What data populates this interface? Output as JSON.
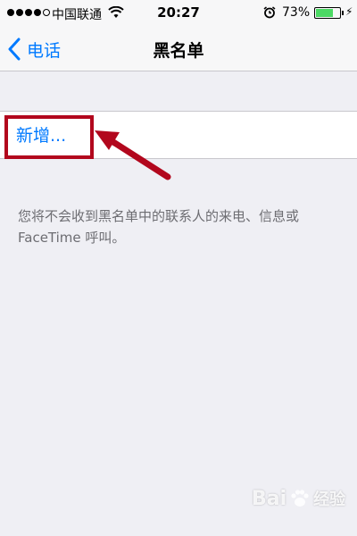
{
  "status_bar": {
    "carrier": "中国联通",
    "time": "20:27",
    "battery_percent": "73%",
    "battery_level": 0.73,
    "signal_bars_filled": 4,
    "icons": [
      "signal-dots-icon",
      "wifi-icon",
      "alarm-icon",
      "battery-icon",
      "charging-icon"
    ]
  },
  "nav": {
    "back_label": "电话",
    "title": "黑名单"
  },
  "list": {
    "add_label": "新增..."
  },
  "footer": {
    "note": "您将不会收到黑名单中的联系人的来电、信息或 FaceTime 呼叫。"
  },
  "annotation": {
    "highlight_color": "#b2071d"
  },
  "watermark": {
    "text_left": "Bai",
    "text_right": "经验"
  },
  "colors": {
    "accent": "#007aff",
    "background": "#efeff4",
    "battery": "#4cd964"
  }
}
